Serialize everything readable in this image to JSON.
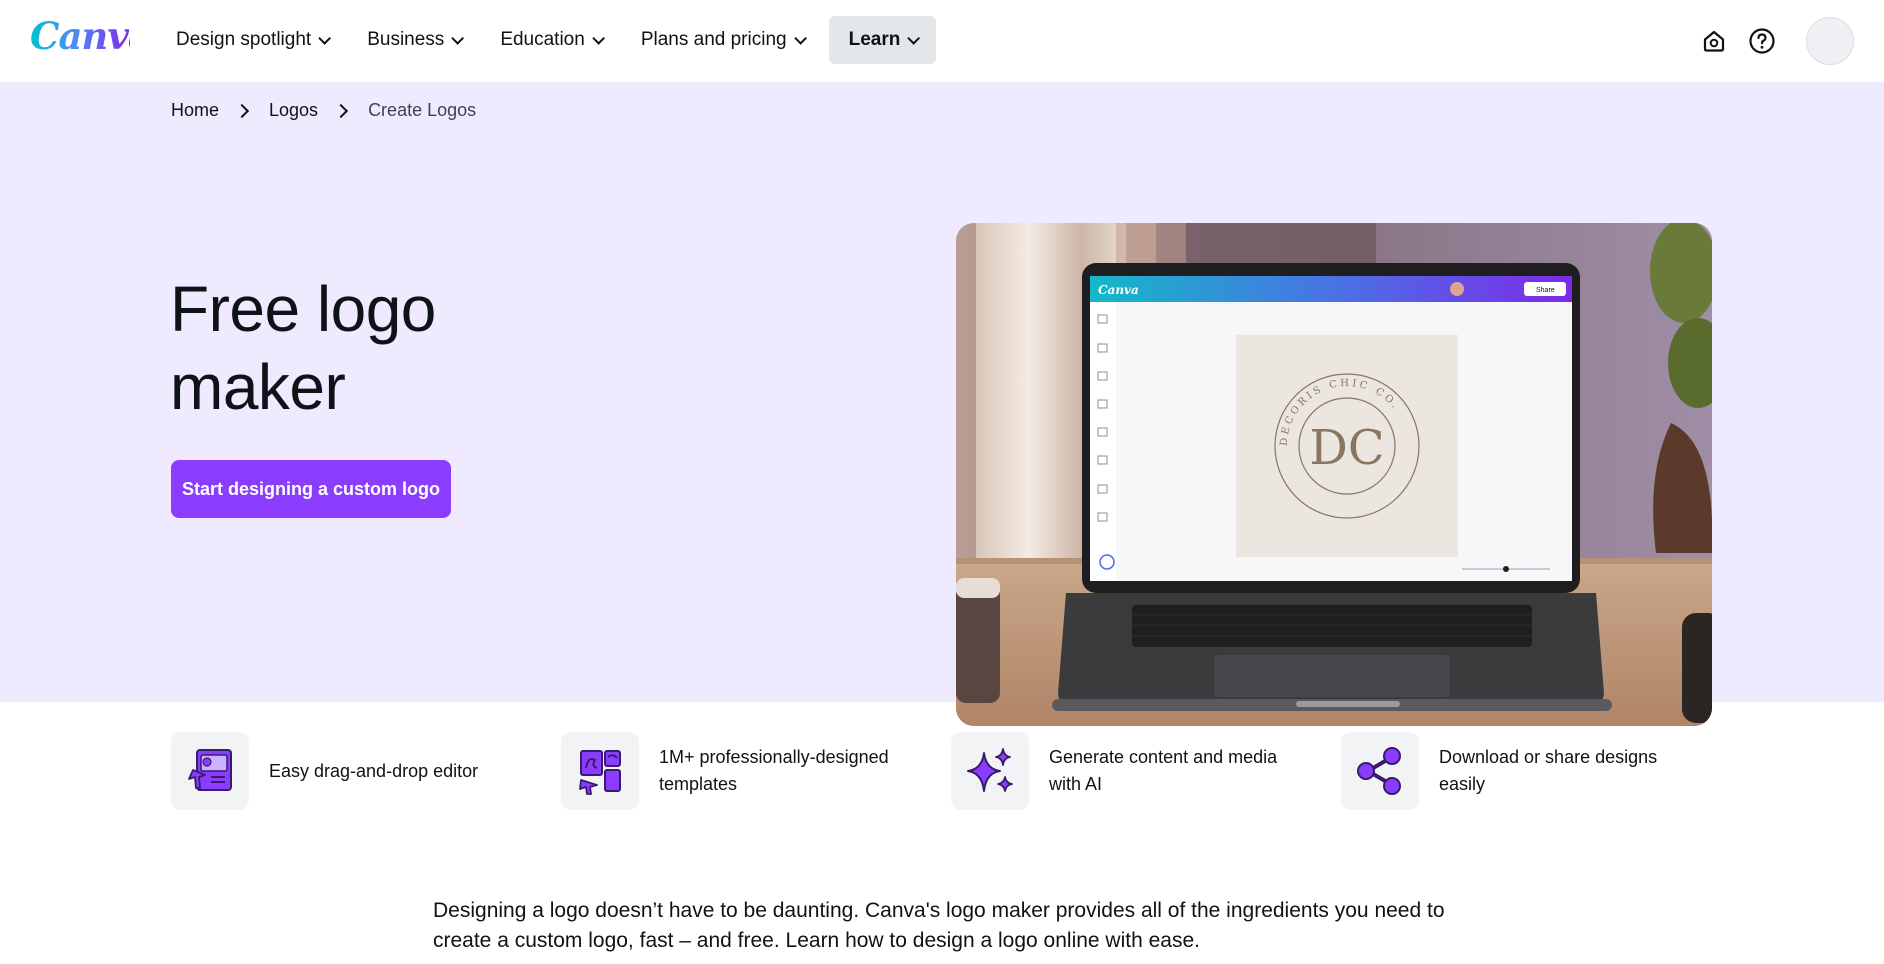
{
  "brand": {
    "name": "Canva",
    "accent": "#8b3dff",
    "hero_bg": "#efeafd"
  },
  "nav": {
    "items": [
      {
        "label": "Design spotlight"
      },
      {
        "label": "Business"
      },
      {
        "label": "Education"
      },
      {
        "label": "Plans and pricing"
      },
      {
        "label": "Learn"
      }
    ],
    "icons": [
      "home-icon",
      "help-icon",
      "avatar"
    ]
  },
  "breadcrumb": [
    "Home",
    "Logos",
    "Create Logos"
  ],
  "hero": {
    "title": "Free logo maker",
    "cta_label": "Start designing a custom logo",
    "image": {
      "app_name": "Canva",
      "share_label": "Share",
      "logo_initials": "DC",
      "logo_ring_text": "DECORIS CHIC CO."
    }
  },
  "features": [
    {
      "icon": "drag-drop-editor-icon",
      "text": "Easy drag-and-drop editor"
    },
    {
      "icon": "templates-icon",
      "text": "1M+ professionally-designed templates"
    },
    {
      "icon": "sparkles-ai-icon",
      "text": "Generate content and media with AI"
    },
    {
      "icon": "share-icon",
      "text": "Download or share designs easily"
    }
  ],
  "intro": "Designing a logo doesn’t have to be daunting. Canva's logo maker provides all of the ingredients you need to create a custom logo, fast – and free. Learn how to design a logo online with ease."
}
